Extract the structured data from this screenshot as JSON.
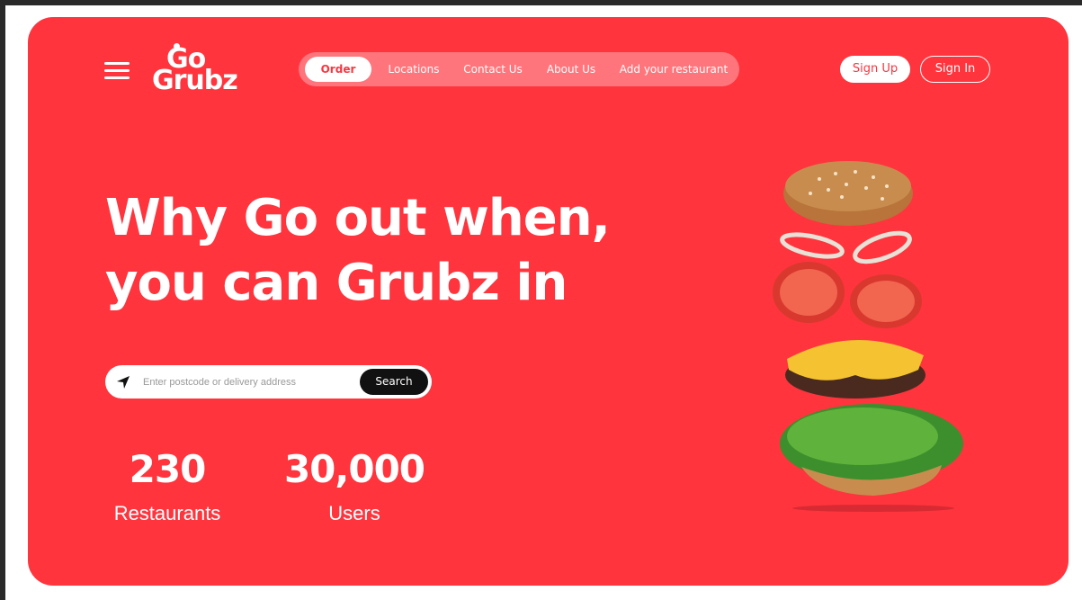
{
  "brand": {
    "logo_top": "Go",
    "logo_bottom": "Grubz"
  },
  "nav": {
    "items": [
      {
        "label": "Order",
        "active": true
      },
      {
        "label": "Locations",
        "active": false
      },
      {
        "label": "Contact Us",
        "active": false
      },
      {
        "label": "About Us",
        "active": false
      },
      {
        "label": "Add your restaurant",
        "active": false
      }
    ]
  },
  "auth": {
    "sign_up": "Sign Up",
    "sign_in": "Sign In"
  },
  "hero": {
    "line1": "Why Go out when,",
    "line2": "you can Grubz in"
  },
  "search": {
    "placeholder": "Enter postcode or delivery address",
    "value": "",
    "button": "Search"
  },
  "stats": [
    {
      "value": "230",
      "label": "Restaurants"
    },
    {
      "value": "30,000",
      "label": "Users"
    }
  ],
  "icons": {
    "menu": "hamburger-icon",
    "location": "location-arrow-icon"
  },
  "colors": {
    "brand_red": "#ff343d",
    "white": "#ffffff",
    "black": "#111111"
  }
}
